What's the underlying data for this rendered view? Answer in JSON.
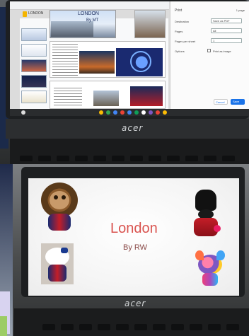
{
  "top_photo": {
    "browser_doc_title": "LONDON",
    "slide_title": "LONDON",
    "slide_subtitle": "By MT",
    "print_panel": {
      "title": "Print",
      "pages_count": "1 page",
      "rows": [
        {
          "label": "Destination",
          "value": "Save as PDF"
        },
        {
          "label": "Pages",
          "value": "All"
        },
        {
          "label": "Pages per sheet",
          "value": "1"
        },
        {
          "label": "Options",
          "value": "Print as image"
        }
      ],
      "cancel_label": "Cancel",
      "save_label": "Save"
    },
    "laptop_brand": "acer"
  },
  "bottom_photo": {
    "slide_title": "London",
    "slide_subtitle": "By RW",
    "laptop_brand": "acer"
  },
  "colors": {
    "slide_title_red": "#d9534f",
    "print_blue": "#1a73e8",
    "lavender_bg": "#d8d3f0"
  }
}
